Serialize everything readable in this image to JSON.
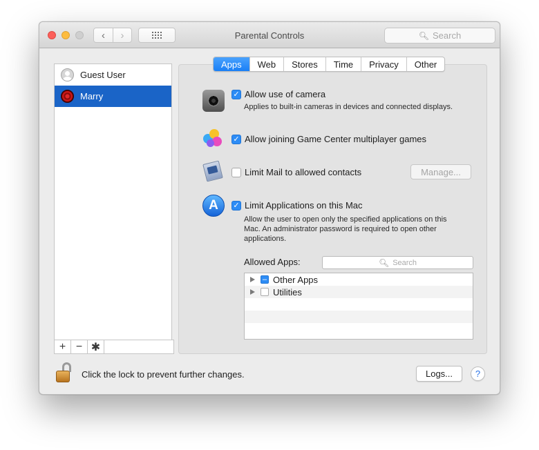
{
  "window": {
    "title": "Parental Controls",
    "search_placeholder": "Search",
    "back_glyph": "‹",
    "forward_glyph": "›"
  },
  "users": [
    {
      "name": "Guest User",
      "icon": "guest-avatar",
      "selected": false
    },
    {
      "name": "Marry",
      "icon": "rose-avatar",
      "selected": true
    }
  ],
  "list_controls": {
    "add": "+",
    "remove": "−",
    "gear": "✱"
  },
  "tabs": [
    {
      "label": "Apps",
      "active": true
    },
    {
      "label": "Web",
      "active": false
    },
    {
      "label": "Stores",
      "active": false
    },
    {
      "label": "Time",
      "active": false
    },
    {
      "label": "Privacy",
      "active": false
    },
    {
      "label": "Other",
      "active": false
    }
  ],
  "options": {
    "camera": {
      "label": "Allow use of camera",
      "checked": true,
      "description": "Applies to built-in cameras in devices and connected displays."
    },
    "game_center": {
      "label": "Allow joining Game Center multiplayer games",
      "checked": true
    },
    "mail": {
      "label": "Limit Mail to allowed contacts",
      "checked": false,
      "manage_button": "Manage..."
    },
    "applications": {
      "label": "Limit Applications on this Mac",
      "checked": true,
      "description": [
        "Allow the user to open only the specified applications on this",
        "Mac. An administrator password is required to open other",
        "applications."
      ]
    }
  },
  "allowed_apps": {
    "label": "Allowed Apps:",
    "search_placeholder": "Search",
    "items": [
      {
        "label": "Other Apps",
        "state": "mixed"
      },
      {
        "label": "Utilities",
        "state": "unchecked"
      }
    ]
  },
  "footer": {
    "lock_text": "Click the lock to prevent further changes.",
    "logs_button": "Logs...",
    "help": "?"
  },
  "colors": {
    "accent": "#1a7ff6",
    "selection": "#1a64c7"
  }
}
